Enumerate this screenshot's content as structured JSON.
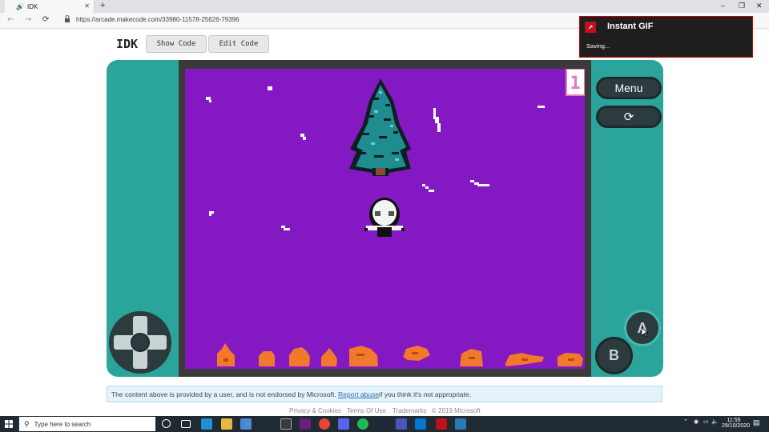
{
  "browser": {
    "tab_title": "IDK",
    "tab_speaker_icon": "speaker-icon",
    "tab_close_glyph": "✕",
    "new_tab_glyph": "+",
    "window_controls": [
      "–",
      "❐",
      "✕"
    ],
    "url": "https://arcade.makecode.com/33980-11578-25626-79396"
  },
  "header": {
    "project_title": "IDK",
    "show_code_label": "Show Code",
    "edit_code_label": "Edit Code"
  },
  "simulator": {
    "menu_label": "Menu",
    "restart_icon": "refresh-icon",
    "a_label": "A",
    "b_label": "B",
    "score": "1",
    "colors": {
      "console": "#2ba49c",
      "screen_bg": "#8418c2",
      "bezel": "#3a3a3a",
      "ground": "#f2782b"
    }
  },
  "notice": {
    "text_before": "The content above is provided by a user, and is not endorsed by Microsoft.",
    "link": "Report abuse",
    "text_after": " if you think it's not appropriate."
  },
  "footer": {
    "privacy": "Privacy & Cookies",
    "terms": "Terms Of Use",
    "trademarks": "Trademarks",
    "copyright": "© 2019 Microsoft"
  },
  "gif_popup": {
    "title": "Instant GIF",
    "status": "Saving..."
  },
  "taskbar": {
    "search_placeholder": "Type here to search",
    "time": "11:55",
    "date": "29/10/2020"
  }
}
